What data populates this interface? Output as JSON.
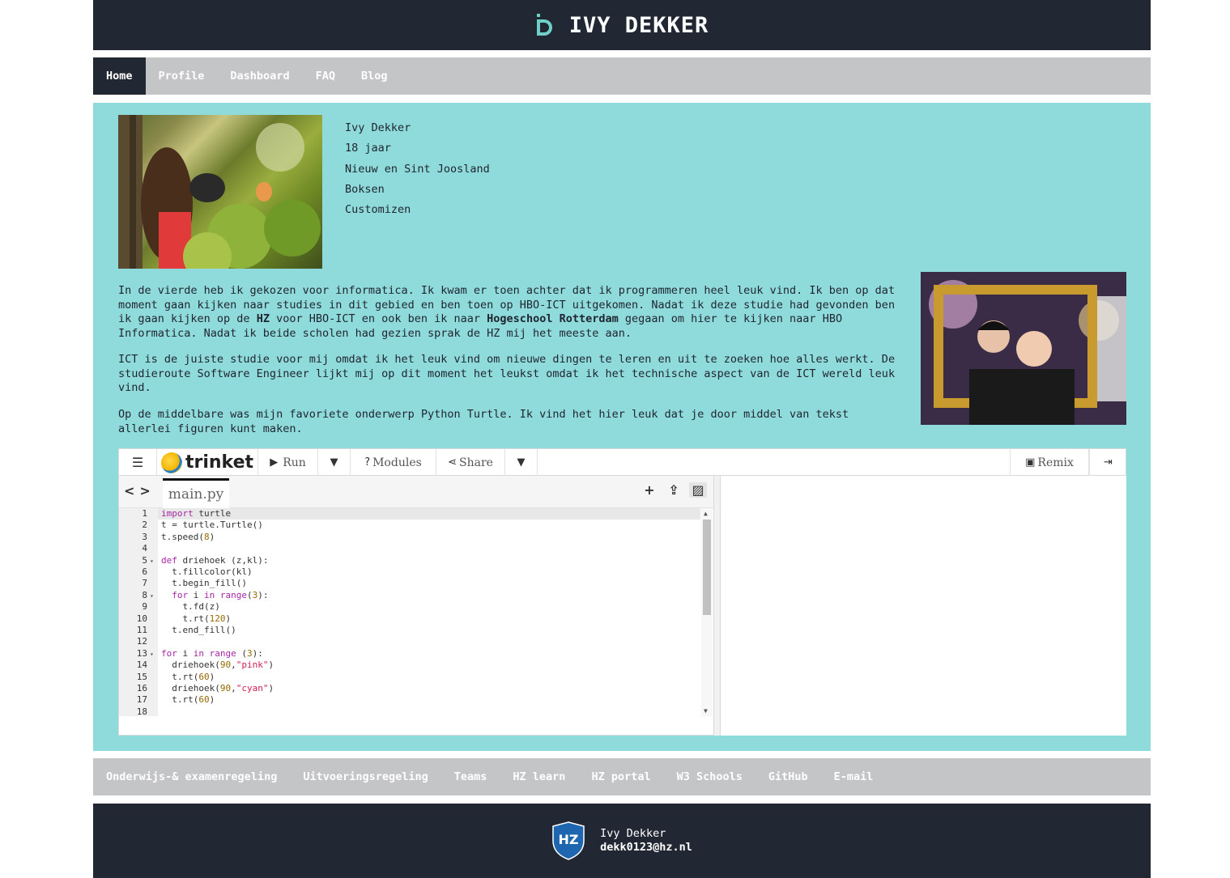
{
  "header": {
    "title": "IVY DEKKER"
  },
  "nav": [
    {
      "label": "Home",
      "active": true
    },
    {
      "label": "Profile"
    },
    {
      "label": "Dashboard"
    },
    {
      "label": "FAQ"
    },
    {
      "label": "Blog"
    }
  ],
  "profile": {
    "lines": [
      "Ivy Dekker",
      "18 jaar",
      "Nieuw en Sint Joosland",
      "Boksen",
      "Customizen"
    ]
  },
  "paragraphs": {
    "p1_a": "In de vierde heb ik gekozen voor informatica. Ik kwam er toen achter dat ik programmeren heel leuk vind. Ik ben op dat moment gaan kijken naar studies in dit gebied en ben toen op HBO-ICT uitgekomen. Nadat ik deze studie had gevonden ben ik gaan kijken op de ",
    "p1_b": "HZ",
    "p1_c": " voor HBO-ICT en ook ben ik naar ",
    "p1_d": "Hogeschool Rotterdam",
    "p1_e": " gegaan om hier te kijken naar HBO Informatica. Nadat ik beide scholen had gezien sprak de HZ mij het meeste aan.",
    "p2": "ICT is de juiste studie voor mij omdat ik het leuk vind om nieuwe dingen te leren en uit te zoeken hoe alles werkt. De studieroute Software Engineer lijkt mij op dit moment het leukst omdat ik het technische aspect van de ICT wereld leuk vind.",
    "p3": "Op de middelbare was mijn favoriete onderwerp Python Turtle. Ik vind het hier leuk dat je door middel van tekst allerlei figuren kunt maken."
  },
  "trinket": {
    "brand": "trinket",
    "run": "Run",
    "modules": "Modules",
    "share": "Share",
    "remix": "Remix",
    "tab": "main.py",
    "lines": [
      "1",
      "2",
      "3",
      "4",
      "5",
      "6",
      "7",
      "8",
      "9",
      "10",
      "11",
      "12",
      "13",
      "14",
      "15",
      "16",
      "17",
      "18"
    ]
  },
  "links": [
    "Onderwijs-& examenregeling",
    "Uitvoeringsregeling",
    "Teams",
    "HZ learn",
    "HZ portal",
    "W3 Schools",
    "GitHub",
    "E-mail"
  ],
  "footer": {
    "name": "Ivy Dekker",
    "email": "dekk0123@hz.nl"
  },
  "colors": {
    "dark": "#222833",
    "nav_bg": "#c4c5c7",
    "main_bg": "#8fdadb",
    "logo_accent": "#6fd0c8"
  },
  "icons": {
    "logo": "d-logo-icon",
    "footer": "hz-shield-icon"
  }
}
